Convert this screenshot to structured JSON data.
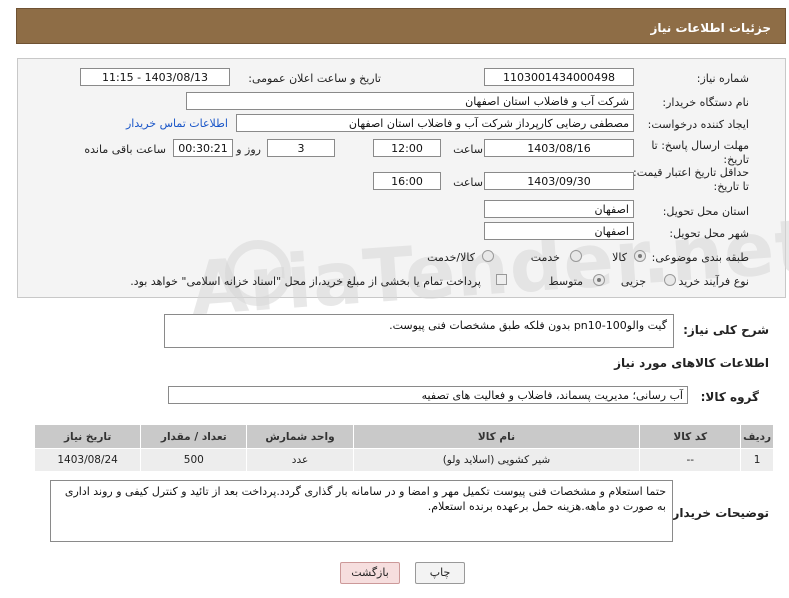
{
  "header": {
    "title": "جزئیات اطلاعات نیاز"
  },
  "form": {
    "need_number_label": "شماره نیاز:",
    "need_number": "1103001434000498",
    "announce_label": "تاریخ و ساعت اعلان عمومی:",
    "announce_value": "1403/08/13 - 11:15",
    "buyer_org_label": "نام دستگاه خریدار:",
    "buyer_org": "شرکت آب و فاضلاب استان اصفهان",
    "creator_label": "ایجاد کننده درخواست:",
    "creator": "مصطفی رضایی کارپرداز شرکت آب و فاضلاب استان اصفهان",
    "contact_link": "اطلاعات تماس خریدار",
    "reply_deadline_label": "مهلت ارسال پاسخ: تا تاریخ:",
    "reply_date": "1403/08/16",
    "time_label": "ساعت",
    "reply_time": "12:00",
    "days_value": "3",
    "days_label": "روز و",
    "remaining_time": "00:30:21",
    "remaining_label": "ساعت باقی مانده",
    "price_validity_label": "حداقل تاریخ اعتبار قیمت: تا تاریخ:",
    "price_date": "1403/09/30",
    "price_time": "16:00",
    "province_label": "استان محل تحویل:",
    "province": "اصفهان",
    "city_label": "شهر محل تحویل:",
    "city": "اصفهان",
    "category_label": "طبقه بندی موضوعی:",
    "category_options": [
      "کالا",
      "خدمت",
      "کالا/خدمت"
    ],
    "process_label": "نوع فرآیند خرید :",
    "process_options": [
      "جزیی",
      "متوسط"
    ],
    "payment_note": "پرداخت تمام یا بخشی از مبلغ خرید،از محل \"اسناد خزانه اسلامی\" خواهد بود."
  },
  "description": {
    "label": "شرح کلی نیاز:",
    "text": "گیت والوpn10-100 بدون فلکه طبق مشخصات فنی پیوست."
  },
  "goods": {
    "section_title": "اطلاعات کالاهای مورد نیاز",
    "group_label": "گروه کالا:",
    "group_value": "آب رسانی؛ مدیریت پسماند، فاضلاب و فعالیت های تصفیه",
    "columns": [
      "ردیف",
      "کد کالا",
      "نام کالا",
      "واحد شمارش",
      "تعداد / مقدار",
      "تاریخ نیاز"
    ],
    "rows": [
      [
        "1",
        "--",
        "شیر کشویی (اسلاید ولو)",
        "عدد",
        "500",
        "1403/08/24"
      ]
    ]
  },
  "buyer_notes": {
    "label": "توضیحات خریدار:",
    "text": "حتما استعلام و مشخصات فنی پیوست تکمیل مهر و امضا و در سامانه بار گذاری گردد.پرداخت بعد از تائید و کنترل کیفی و روند اداری به صورت دو ماهه.هزینه حمل برعهده برنده استعلام."
  },
  "buttons": {
    "print": "چاپ",
    "back": "بازگشت"
  },
  "watermark": "AriaTender.net",
  "colors": {
    "header_bg": "#8e6d46",
    "link": "#1a56c8",
    "back_btn_bg": "#f6dede"
  }
}
